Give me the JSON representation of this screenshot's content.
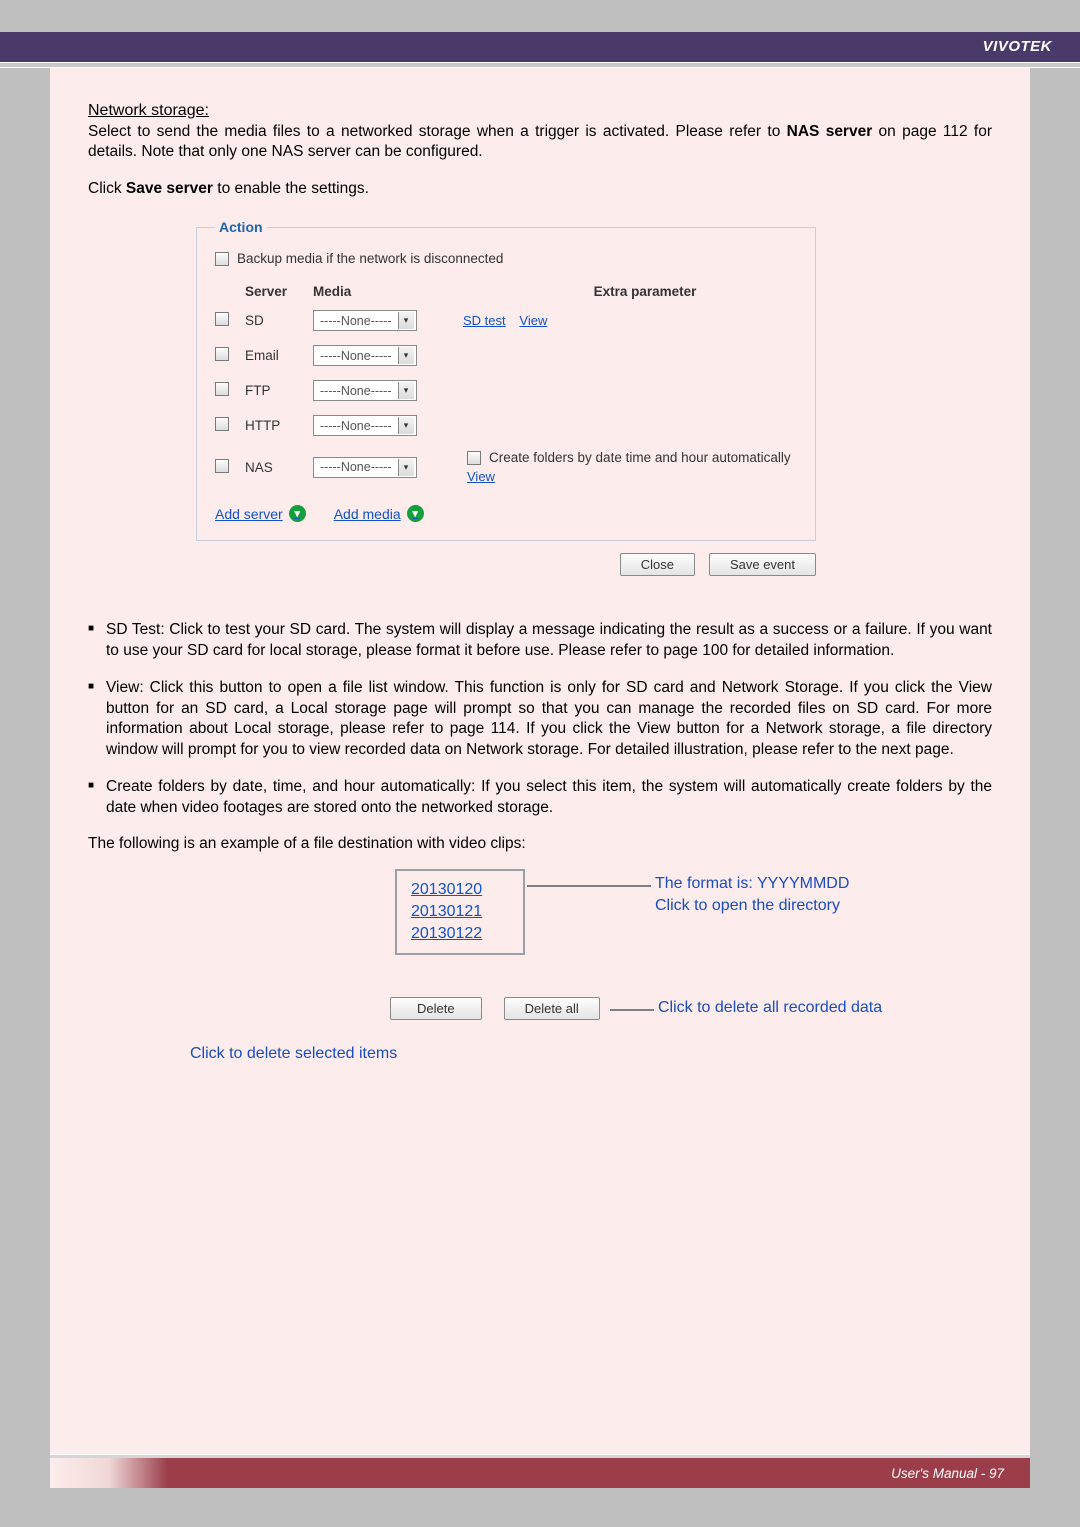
{
  "header": {
    "brand": "VIVOTEK"
  },
  "intro": {
    "heading": "Network storage:",
    "para1_a": "Select to send the media files to a networked storage when a trigger is activated. Please refer to ",
    "para1_b": "NAS server",
    "para1_c": " on page 112 for details. Note that only one NAS server can be configured.",
    "para2_a": "Click ",
    "para2_b": "Save server",
    "para2_c": " to enable the settings."
  },
  "action": {
    "legend": "Action",
    "backup_label": "Backup media if the network is disconnected",
    "headers": {
      "server": "Server",
      "media": "Media",
      "extra": "Extra parameter"
    },
    "rows": {
      "sd": {
        "name": "SD",
        "media": "-----None-----",
        "links": {
          "sdtest": "SD test",
          "view": "View"
        }
      },
      "email": {
        "name": "Email",
        "media": "-----None-----"
      },
      "ftp": {
        "name": "FTP",
        "media": "-----None-----"
      },
      "http": {
        "name": "HTTP",
        "media": "-----None-----"
      },
      "nas": {
        "name": "NAS",
        "media": "-----None-----",
        "create_label": "Create folders by date time and hour automatically",
        "view": "View"
      }
    },
    "add_server": "Add server",
    "add_media": "Add media",
    "buttons": {
      "close": "Close",
      "save": "Save event"
    }
  },
  "bullets": {
    "b1": "SD Test: Click to test your SD card. The system will display a message indicating the result as a success or a failure. If you want to use your SD card for local storage, please format it before use. Please refer to page 100 for detailed information.",
    "b2": "View: Click this button to open a file list window. This function is only for SD card and Network Storage. If you click the View button for an SD card, a Local storage page will prompt so that you can manage the recorded files on SD card. For more information about Local storage, please refer to page 114. If you click the View button for a Network storage, a file directory window will prompt for you to view recorded data on Network storage. For detailed illustration, please refer to the next page.",
    "b3": "Create folders by date, time, and hour automatically: If you select this item, the system will automatically create folders by the date when video footages are stored onto the networked storage."
  },
  "example": {
    "lead": "The following is an example of a file destination with video clips:",
    "dirs": [
      "20130120",
      "20130121",
      "20130122"
    ],
    "delete": "Delete",
    "delete_all": "Delete all",
    "ann_format": "The format is: YYYYMMDD",
    "ann_open": "Click to open the directory",
    "ann_delall": "Click to delete all recorded data",
    "ann_delsel": "Click to delete selected items"
  },
  "footer": {
    "text": "User's Manual - 97"
  }
}
